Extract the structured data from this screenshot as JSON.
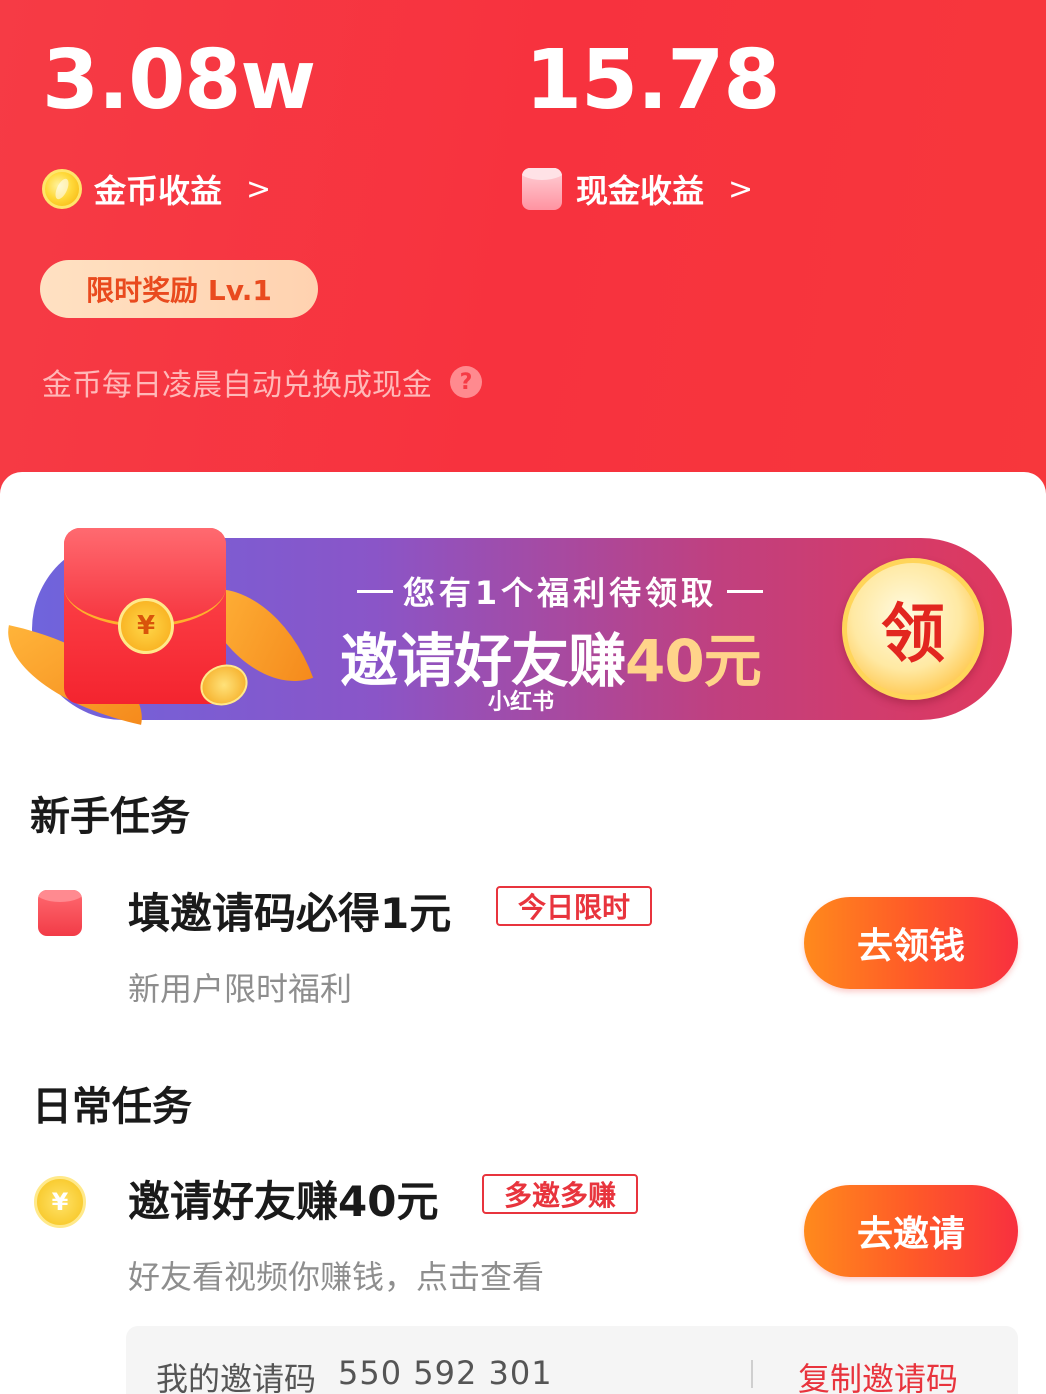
{
  "header": {
    "coins_value": "3.08w",
    "cash_value": "15.78",
    "coins_label": "金币收益",
    "cash_label": "现金收益",
    "chevron": ">",
    "reward_pill": "限时奖励 Lv.1",
    "exchange_note": "金币每日凌晨自动兑换成现金",
    "help_glyph": "?"
  },
  "banner": {
    "top_text": "您有1个福利待领取",
    "main_text": "邀请好友赚",
    "main_amount": "40元",
    "claim_label": "领",
    "coin_glyph": "¥",
    "watermark": "小红书"
  },
  "newbie_section": {
    "title": "新手任务",
    "task": {
      "icon": "cash-envelope-icon",
      "title": "填邀请码必得1元",
      "tag": "今日限时",
      "subtitle": "新用户限时福利",
      "button": "去领钱"
    }
  },
  "daily_section": {
    "title": "日常任务",
    "task": {
      "icon": "coin-icon",
      "coin_glyph": "¥",
      "title": "邀请好友赚40元",
      "tag": "多邀多赚",
      "subtitle": "好友看视频你赚钱，点击查看",
      "button": "去邀请"
    }
  },
  "invite": {
    "label": "我的邀请码",
    "code": "550 592 301",
    "copy": "复制邀请码"
  },
  "colors": {
    "header_red": "#f63b45",
    "accent_red": "#e8343d",
    "button_orange": "#ff8a1c",
    "pill_text": "#e94a1e"
  }
}
